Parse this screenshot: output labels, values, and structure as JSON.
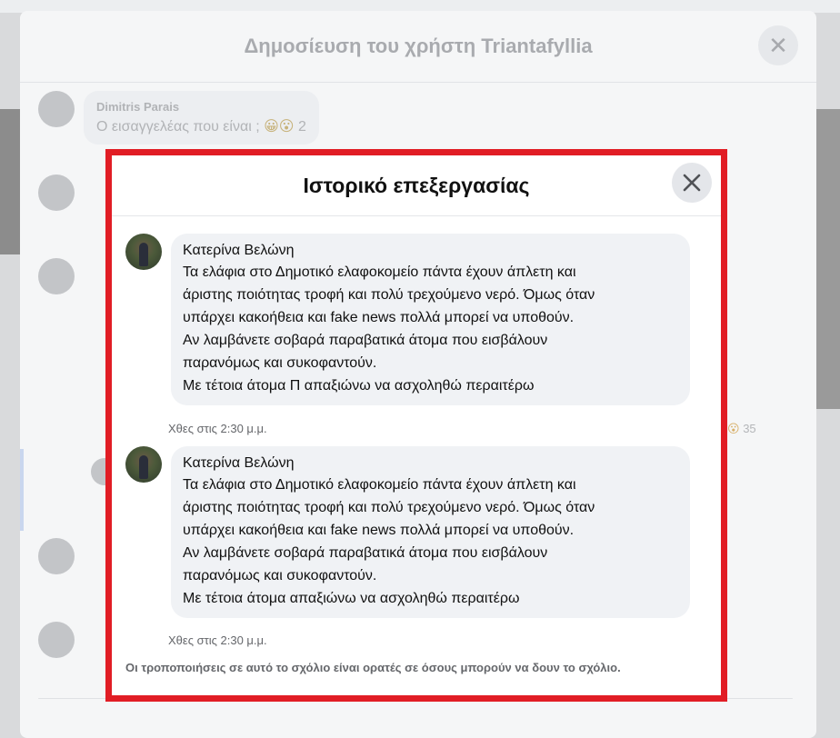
{
  "post": {
    "title": "Δημοσίευση του χρήστη Triantafyllia",
    "first_comment": {
      "name": "Dimitris Parais",
      "text": "Ο εισαγγελέας που είναι ;",
      "reaction_count": "2"
    },
    "side_reaction_count": "35"
  },
  "dialog": {
    "title": "Ιστορικό επεξεργασίας",
    "close_icon": "close-icon",
    "entries": [
      {
        "author": "Κατερίνα Βελώνη",
        "lines": [
          "Τα ελάφια στο Δημοτικό ελαφοκομείο πάντα έχουν άπλετη και",
          "άριστης ποιότητας τροφή και πολύ τρεχούμενο νερό. Όμως όταν",
          "υπάρχει κακοήθεια και fake news πολλά μπορεί να υποθούν.",
          "Αν λαμβάνετε σοβαρά παραβατικά άτομα που εισβάλουν",
          "παρανόμως και συκοφαντούν.",
          "Με τέτοια άτομα Π απαξιώνω να ασχοληθώ περαιτέρω"
        ],
        "time": "Χθες στις 2:30 μ.μ."
      },
      {
        "author": "Κατερίνα Βελώνη",
        "lines": [
          "Τα ελάφια στο Δημοτικό ελαφοκομείο πάντα έχουν άπλετη και",
          "άριστης ποιότητας τροφή και πολύ τρεχούμενο νερό. Όμως όταν",
          "υπάρχει κακοήθεια και fake news πολλά μπορεί να υποθούν.",
          "Αν λαμβάνετε σοβαρά παραβατικά άτομα που εισβάλουν",
          "παρανόμως και συκοφαντούν.",
          "Με τέτοια άτομα απαξιώνω να ασχοληθώ περαιτέρω"
        ],
        "time": "Χθες στις 2:30 μ.μ."
      }
    ],
    "footer": "Οι τροποποιήσεις σε αυτό το σχόλιο είναι ορατές σε όσους μπορούν να δουν το σχόλιο."
  },
  "colors": {
    "highlight_border": "#e11d25",
    "bubble": "#f0f2f5",
    "secondary_text": "#65676b"
  }
}
